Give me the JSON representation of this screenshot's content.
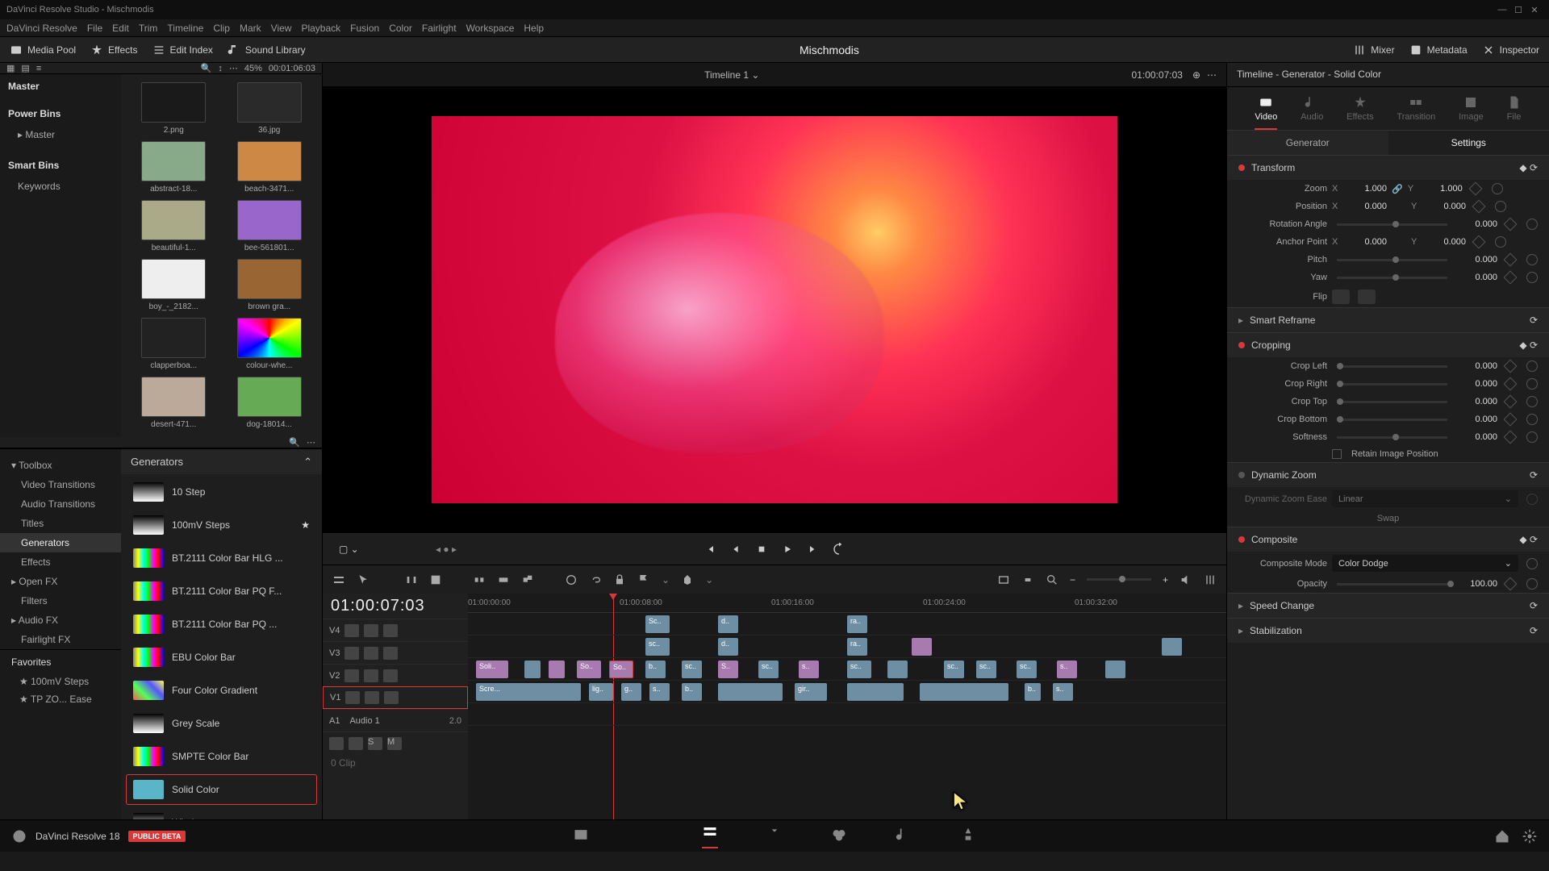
{
  "titlebar": {
    "app": "DaVinci Resolve Studio - Mischmodis"
  },
  "menubar": [
    "DaVinci Resolve",
    "File",
    "Edit",
    "Trim",
    "Timeline",
    "Clip",
    "Mark",
    "View",
    "Playback",
    "Fusion",
    "Color",
    "Fairlight",
    "Workspace",
    "Help"
  ],
  "toolbar": {
    "media_pool": "Media Pool",
    "effects": "Effects",
    "edit_index": "Edit Index",
    "sound_library": "Sound Library",
    "project_title": "Mischmodis",
    "mixer": "Mixer",
    "metadata": "Metadata",
    "inspector": "Inspector"
  },
  "pool_toolbar": {
    "zoom_pct": "45%",
    "timecode": "00:01:06:03"
  },
  "viewer_header": {
    "timeline_name": "Timeline 1",
    "timecode": "01:00:07:03"
  },
  "bins": {
    "master": "Master",
    "power": "Power Bins",
    "power_master": "Master",
    "smart": "Smart Bins",
    "keywords": "Keywords"
  },
  "thumbs": [
    {
      "name": "2.png"
    },
    {
      "name": "36.jpg"
    },
    {
      "name": "abstract-18..."
    },
    {
      "name": "beach-3471..."
    },
    {
      "name": "beautiful-1..."
    },
    {
      "name": "bee-561801..."
    },
    {
      "name": "boy_-_2182..."
    },
    {
      "name": "brown gra..."
    },
    {
      "name": "clapperboa..."
    },
    {
      "name": "colour-whe..."
    },
    {
      "name": "desert-471..."
    },
    {
      "name": "dog-18014..."
    }
  ],
  "fx_tree": {
    "toolbox": "Toolbox",
    "video_transitions": "Video Transitions",
    "audio_transitions": "Audio Transitions",
    "titles": "Titles",
    "generators": "Generators",
    "effects": "Effects",
    "openfx": "Open FX",
    "filters": "Filters",
    "audiofx": "Audio FX",
    "fairlight_fx": "Fairlight FX"
  },
  "fx_list": {
    "header": "Generators",
    "items": [
      {
        "name": "10 Step"
      },
      {
        "name": "100mV Steps",
        "fav": true
      },
      {
        "name": "BT.2111 Color Bar HLG ..."
      },
      {
        "name": "BT.2111 Color Bar PQ F..."
      },
      {
        "name": "BT.2111 Color Bar PQ ..."
      },
      {
        "name": "EBU Color Bar"
      },
      {
        "name": "Four Color Gradient"
      },
      {
        "name": "Grey Scale"
      },
      {
        "name": "SMPTE Color Bar"
      },
      {
        "name": "Solid Color",
        "sel": true
      },
      {
        "name": "Window"
      }
    ]
  },
  "favorites": {
    "header": "Favorites",
    "items": [
      "100mV Steps",
      "TP ZO... Ease"
    ]
  },
  "timeline": {
    "big_tc": "01:00:07:03",
    "ruler": [
      "01:00:00:00",
      "01:00:08:00",
      "01:00:16:00",
      "01:00:24:00",
      "01:00:32:00"
    ],
    "tracks": [
      {
        "name": "V4"
      },
      {
        "name": "V3"
      },
      {
        "name": "V2"
      },
      {
        "name": "V1",
        "sel": true
      },
      {
        "name": "A1",
        "label": "Audio 1",
        "meta": "2.0"
      }
    ],
    "clip_count": "0 Clip"
  },
  "inspector": {
    "title": "Timeline - Generator - Solid Color",
    "tabs": {
      "video": "Video",
      "audio": "Audio",
      "effects": "Effects",
      "transition": "Transition",
      "image": "Image",
      "file": "File"
    },
    "mode": {
      "generator": "Generator",
      "settings": "Settings"
    },
    "transform": {
      "header": "Transform",
      "zoom_label": "Zoom",
      "zoom_x": "1.000",
      "zoom_y": "1.000",
      "position_label": "Position",
      "pos_x": "0.000",
      "pos_y": "0.000",
      "rotation_label": "Rotation Angle",
      "rotation": "0.000",
      "anchor_label": "Anchor Point",
      "anchor_x": "0.000",
      "anchor_y": "0.000",
      "pitch_label": "Pitch",
      "pitch": "0.000",
      "yaw_label": "Yaw",
      "yaw": "0.000",
      "flip_label": "Flip"
    },
    "smart_reframe": "Smart Reframe",
    "cropping": {
      "header": "Cropping",
      "left_label": "Crop Left",
      "left": "0.000",
      "right_label": "Crop Right",
      "right": "0.000",
      "top_label": "Crop Top",
      "top": "0.000",
      "bottom_label": "Crop Bottom",
      "bottom": "0.000",
      "softness_label": "Softness",
      "softness": "0.000",
      "retain": "Retain Image Position"
    },
    "dynamic_zoom": {
      "header": "Dynamic Zoom",
      "ease_label": "Dynamic Zoom Ease",
      "ease": "Linear",
      "swap": "Swap"
    },
    "composite": {
      "header": "Composite",
      "mode_label": "Composite Mode",
      "mode": "Color Dodge",
      "opacity_label": "Opacity",
      "opacity": "100.00"
    },
    "speed": "Speed Change",
    "stabilization": "Stabilization"
  },
  "bottom": {
    "app_name": "DaVinci Resolve 18",
    "beta": "PUBLIC BETA"
  }
}
